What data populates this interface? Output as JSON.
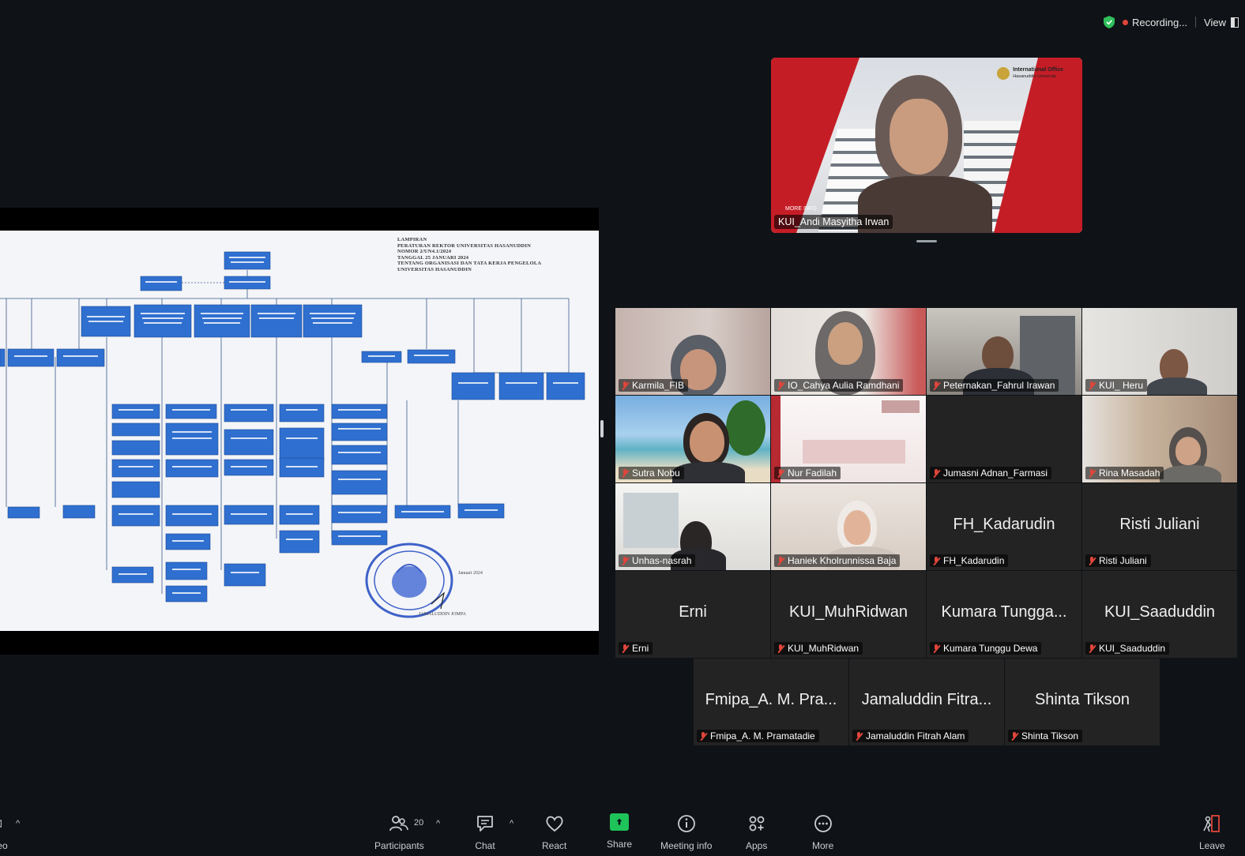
{
  "topbar": {
    "recording_label": "Recording...",
    "view_label": "View"
  },
  "colors": {
    "recording_dot": "#e0453b",
    "share_green": "#1ec35a",
    "shield_green": "#2fbf5a",
    "org_box_blue": "#2f6fd0"
  },
  "shared_document": {
    "header_lines": [
      "LAMPIRAN",
      "PERATURAN REKTOR UNIVERSITAS HASANUDDIN",
      "NOMOR 2/UN4.1/2024",
      "TANGGAL 25 JANUARI 2024",
      "TENTANG ORGANISASI DAN TATA KERJA PENGELOLA",
      "UNIVERSITAS HASANUDDIN"
    ],
    "sign_note": [
      "Januari 2024",
      "JAMALUDDIN JOMPA"
    ]
  },
  "speaker": {
    "name": "KUI_Andi Masyitha Irwan",
    "logo_line1": "International Office",
    "logo_line2": "Hasanuddin University",
    "more_info": "MORE INFO"
  },
  "gallery": {
    "tiles": [
      {
        "name": "Karmila_FIB",
        "video": true
      },
      {
        "name": "IO_Cahya Aulia Ramdhani",
        "video": true
      },
      {
        "name": "Peternakan_Fahrul Irawan",
        "video": true
      },
      {
        "name": "KUI_ Heru",
        "video": true
      },
      {
        "name": "Sutra Nobu",
        "video": true
      },
      {
        "name": "Nur Fadilah",
        "video": true
      },
      {
        "name": "Jumasni Adnan_Farmasi",
        "video": false,
        "display": ""
      },
      {
        "name": "Rina Masadah",
        "video": true
      },
      {
        "name": "Unhas-nasrah",
        "video": true
      },
      {
        "name": "Haniek Kholrunnissa Baja",
        "video": true
      },
      {
        "name": "FH_Kadarudin",
        "video": false,
        "display": "FH_Kadarudin"
      },
      {
        "name": "Risti Juliani",
        "video": false,
        "display": "Risti Juliani"
      },
      {
        "name": "Erni",
        "video": false,
        "display": "Erni"
      },
      {
        "name": "KUI_MuhRidwan",
        "video": false,
        "display": "KUI_MuhRidwan"
      },
      {
        "name": "Kumara Tunggu Dewa",
        "video": false,
        "display": "Kumara Tungga..."
      },
      {
        "name": "KUI_Saaduddin",
        "video": false,
        "display": "KUI_Saaduddin"
      },
      {
        "name": "Fmipa_A. M. Pramatadie",
        "video": false,
        "display": "Fmipa_A. M. Pra..."
      },
      {
        "name": "Jamaluddin Fitrah Alam",
        "video": false,
        "display": "Jamaluddin Fitra..."
      },
      {
        "name": "Shinta Tikson",
        "video": false,
        "display": "Shinta Tikson"
      }
    ]
  },
  "toolbar": {
    "left_label": "eo",
    "participants_label": "Participants",
    "participants_count": "20",
    "chat_label": "Chat",
    "react_label": "React",
    "share_label": "Share",
    "meeting_info_label": "Meeting info",
    "apps_label": "Apps",
    "more_label": "More",
    "leave_label": "Leave"
  }
}
